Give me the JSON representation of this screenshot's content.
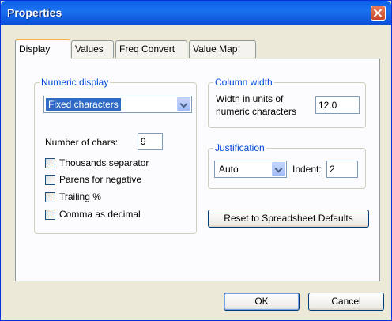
{
  "window": {
    "title": "Properties"
  },
  "tabs": [
    "Display",
    "Values",
    "Freq Convert",
    "Value Map"
  ],
  "numeric_display": {
    "label": "Numeric display",
    "format_value": "Fixed characters",
    "num_chars_label": "Number of chars:",
    "num_chars_value": "9",
    "checkboxes": [
      {
        "label": "Thousands separator",
        "checked": false
      },
      {
        "label": "Parens for negative",
        "checked": false
      },
      {
        "label": "Trailing %",
        "checked": false
      },
      {
        "label": "Comma as decimal",
        "checked": false
      }
    ]
  },
  "column_width": {
    "label": "Column width",
    "desc_line1": "Width in units of",
    "desc_line2": "numeric characters",
    "value": "12.0"
  },
  "justification": {
    "label": "Justification",
    "align_value": "Auto",
    "indent_label": "Indent:",
    "indent_value": "2"
  },
  "reset_button": "Reset to Spreadsheet Defaults",
  "ok_button": "OK",
  "cancel_button": "Cancel"
}
